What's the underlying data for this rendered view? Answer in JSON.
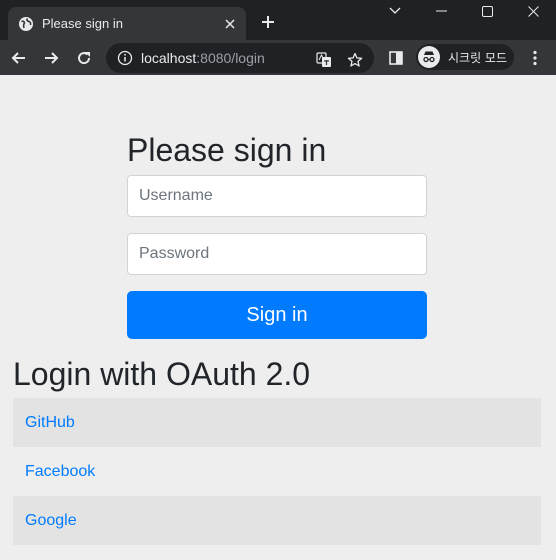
{
  "browser": {
    "tab_title": "Please sign in",
    "url_host": "localhost",
    "url_rest": ":8080/login",
    "incognito_label": "시크릿 모드",
    "icons": [
      "globe-icon",
      "close-icon",
      "plus-icon",
      "chevron-down-icon",
      "minimize-icon",
      "maximize-icon",
      "window-close-icon",
      "back-icon",
      "forward-icon",
      "reload-icon",
      "info-icon",
      "translate-icon",
      "star-icon",
      "sidepanel-icon",
      "incognito-icon",
      "menu-icon"
    ]
  },
  "login": {
    "heading": "Please sign in",
    "username_placeholder": "Username",
    "password_placeholder": "Password",
    "submit_label": "Sign in"
  },
  "oauth": {
    "heading": "Login with OAuth 2.0",
    "providers": [
      "GitHub",
      "Facebook",
      "Google"
    ]
  },
  "colors": {
    "primary": "#007bff",
    "page_bg": "#eeeeee",
    "row_stripe": "#e3e3e3"
  }
}
